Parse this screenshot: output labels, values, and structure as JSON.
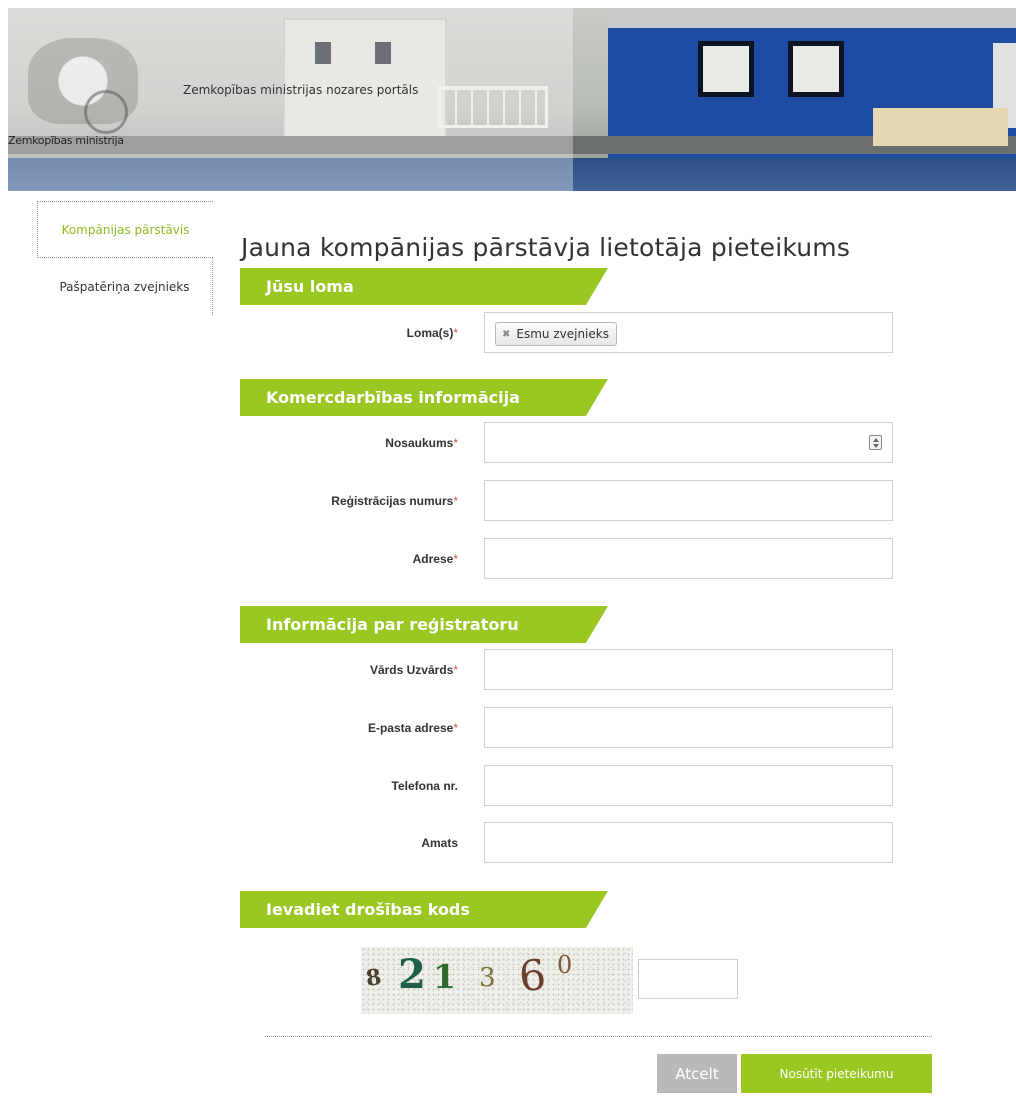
{
  "header": {
    "portal_title": "Zemkopības ministrijas nozares portāls",
    "ministry_name": "Zemkopības ministrija"
  },
  "nav": {
    "items": [
      {
        "label": "Kompānijas pārstāvis",
        "active": true
      },
      {
        "label": "Pašpatēriņa zvejnieks",
        "active": false
      }
    ]
  },
  "page": {
    "title": "Jauna kompānijas pārstāvja lietotāja pieteikums"
  },
  "sections": {
    "role": {
      "title": "Jūsu loma",
      "roles_label": "Loma(s)",
      "selected_role": "Esmu zvejnieks"
    },
    "business": {
      "title": "Komercdarbības informācija",
      "name_label": "Nosaukums",
      "name_value": "",
      "reg_label": "Reģistrācijas numurs",
      "reg_value": "",
      "address_label": "Adrese",
      "address_value": ""
    },
    "registrant": {
      "title": "Informācija par reģistratoru",
      "fullname_label": "Vārds Uzvārds",
      "fullname_value": "",
      "email_label": "E-pasta adrese",
      "email_value": "",
      "phone_label": "Telefona nr.",
      "phone_value": "",
      "position_label": "Amats",
      "position_value": ""
    },
    "security": {
      "title": "Ievadiet drošības kods",
      "captcha_chars": [
        "8",
        "2",
        "1",
        "3",
        "6",
        "0"
      ],
      "captcha_value": ""
    }
  },
  "required_marker": "*",
  "buttons": {
    "cancel": "Atcelt",
    "submit": "Nosūtīt pieteikumu"
  },
  "colors": {
    "accent_green": "#9ac722",
    "nav_active": "#8dbb21",
    "required": "#d9534f",
    "cancel_gray": "#b9b9b9"
  }
}
